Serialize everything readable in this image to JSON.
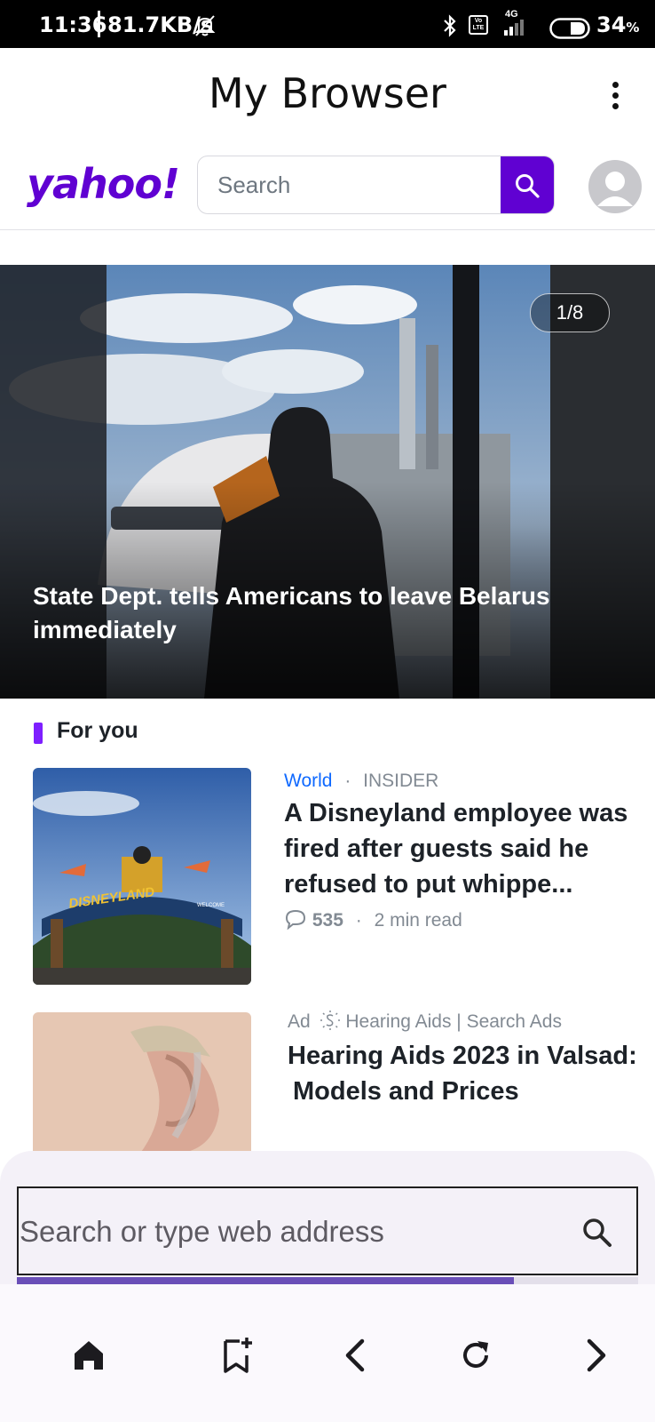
{
  "status_bar": {
    "time": "11:36",
    "speed": "81.7KB/s",
    "network": "4G",
    "volte": "Vo LTE",
    "battery": "34",
    "battery_unit": "%"
  },
  "app_bar": {
    "title": "My Browser",
    "menu_icon": "more-vert-icon"
  },
  "yahoo_header": {
    "logo": "yahoo!",
    "search_placeholder": "Search",
    "search_icon": "search-icon",
    "avatar_icon": "user-avatar-icon"
  },
  "hero": {
    "counter": "1/8",
    "headline": "State Dept. tells Americans to leave Belarus immediately"
  },
  "for_you": {
    "label": "For you",
    "articles": [
      {
        "category": "World",
        "source": "INSIDER",
        "title": "A Disneyland employee was fired after guests said he refused to put whippe...",
        "comments": "535",
        "read_time": "2 min read",
        "sign_text": "DISNEYLAND",
        "thumb_caption": "WELCOME"
      },
      {
        "ad_label": "Ad",
        "sponsor": "Hearing Aids | Search Ads",
        "title": "Hearing Aids 2023 in Valsad: Models and Prices"
      }
    ]
  },
  "address_bar": {
    "placeholder": "Search or type web address",
    "search_icon": "search-icon"
  },
  "load_progress": 0.8,
  "bottom_nav": [
    "home-icon",
    "bookmark-add-icon",
    "back-icon",
    "refresh-icon",
    "forward-icon"
  ],
  "colors": {
    "yahoo_purple": "#6001d2",
    "accent": "#7e1fff",
    "link_blue": "#0f69ff",
    "progress": "#6a4fb8"
  }
}
